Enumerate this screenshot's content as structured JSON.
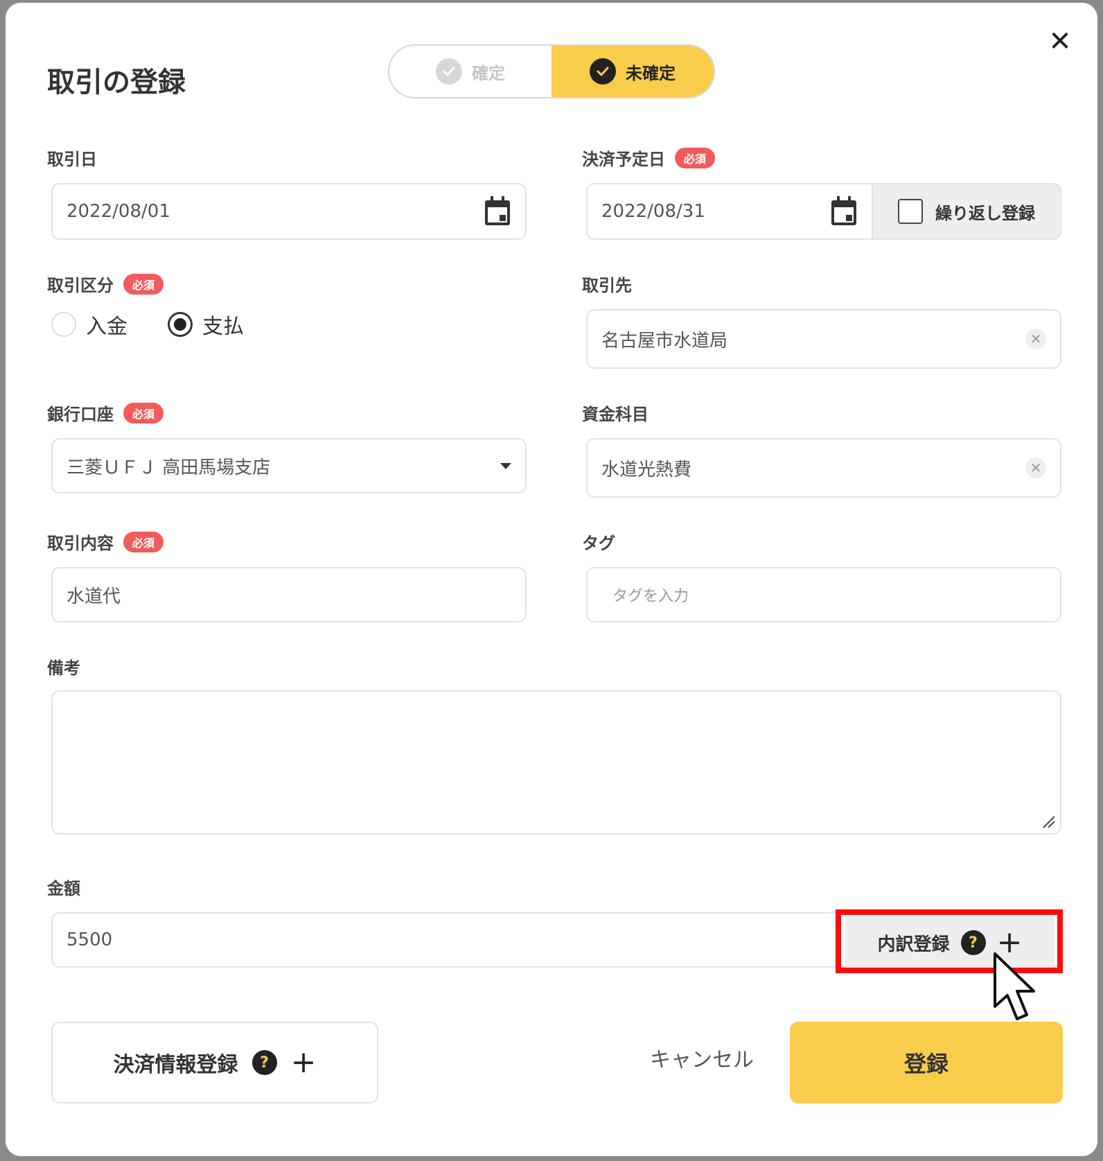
{
  "modal": {
    "title": "取引の登録",
    "close_glyph": "✕",
    "status_toggle": {
      "confirmed": "確定",
      "unconfirmed": "未確定",
      "selected": "未確定"
    }
  },
  "required_badge": "必須",
  "fields": {
    "transaction_date": {
      "label": "取引日",
      "value": "2022/08/01"
    },
    "settlement_date": {
      "label": "決済予定日",
      "value": "2022/08/31",
      "repeat_label": "繰り返し登録"
    },
    "transaction_type": {
      "label": "取引区分",
      "options": [
        "入金",
        "支払"
      ],
      "selected": "支払"
    },
    "partner": {
      "label": "取引先",
      "value": "名古屋市水道局"
    },
    "bank_account": {
      "label": "銀行口座",
      "value": "三菱ＵＦＪ 高田馬場支店"
    },
    "fund_category": {
      "label": "資金科目",
      "value": "水道光熱費"
    },
    "description": {
      "label": "取引内容",
      "value": "水道代"
    },
    "tags": {
      "label": "タグ",
      "placeholder": "タグを入力"
    },
    "notes": {
      "label": "備考",
      "value": ""
    },
    "amount": {
      "label": "金額",
      "value": "5500"
    }
  },
  "buttons": {
    "breakdown": "内訳登録",
    "help_glyph": "?",
    "plus_glyph": "+",
    "payment_info": "決済情報登録",
    "cancel": "キャンセル",
    "submit": "登録"
  },
  "colors": {
    "accent": "#f8cd4c",
    "required": "#f25b5b",
    "highlight": "#ff0a0a"
  }
}
